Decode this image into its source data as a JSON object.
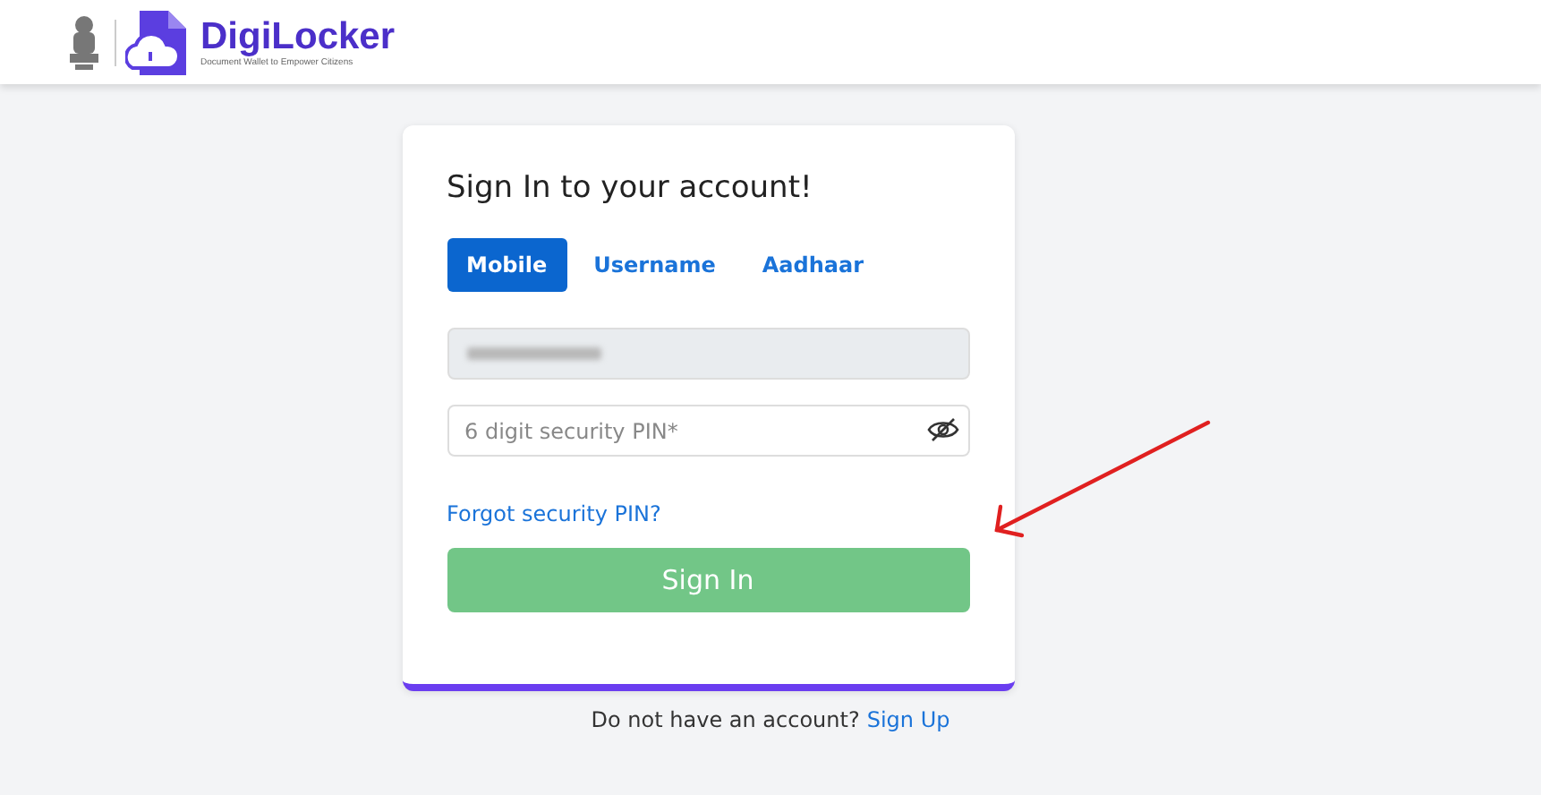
{
  "header": {
    "brand": "DigiLocker",
    "tagline": "Document Wallet to Empower Citizens"
  },
  "card": {
    "title": "Sign In to your account!",
    "tabs": [
      {
        "label": "Mobile",
        "selected": true
      },
      {
        "label": "Username",
        "selected": false
      },
      {
        "label": "Aadhaar",
        "selected": false
      }
    ],
    "mobile_field": {
      "redacted": true
    },
    "pin_field": {
      "placeholder": "6 digit security PIN*",
      "password_hidden": true
    },
    "forgot_link": "Forgot security PIN?",
    "submit": {
      "label": "Sign In",
      "disabled": true
    }
  },
  "footer": {
    "text": "Do not have an account?",
    "link": "Sign Up"
  },
  "annotation": {
    "kind": "arrow"
  }
}
